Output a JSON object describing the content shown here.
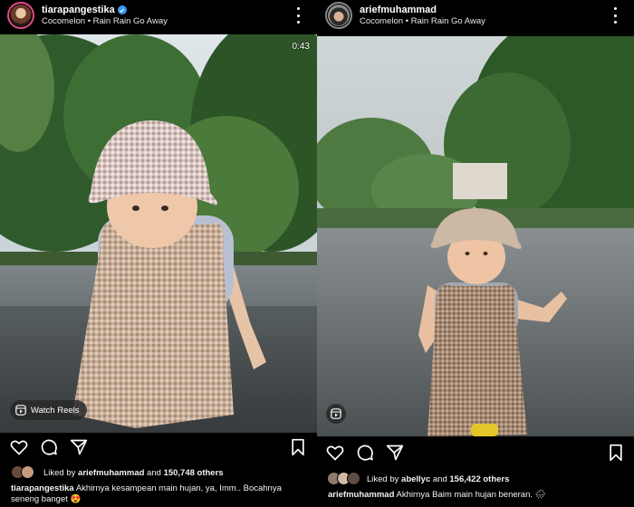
{
  "posts": [
    {
      "username": "tiarapangestika",
      "verified": true,
      "song": "Cocomelon • Rain Rain Go Away",
      "timer": "0:43",
      "badge": "Watch Reels",
      "liked_by_prefix": "Liked by ",
      "liked_by_user": "ariefmuhammad",
      "liked_by_mid": " and ",
      "likes_count": "150,748 others",
      "caption_user": "tiarapangestika",
      "caption_text": " Akhirnya kesampean main hujan, ya, Imm.. Bocahnya seneng banget 😍"
    },
    {
      "username": "ariefmuhammad",
      "verified": false,
      "song": "Cocomelon • Rain Rain Go Away",
      "liked_by_prefix": "Liked by ",
      "liked_by_user": "abellyc",
      "liked_by_mid": " and ",
      "likes_count": "156,422 others",
      "caption_user": "ariefmuhammad",
      "caption_text": " Akhirnya Baim main hujan beneran. 🌧"
    }
  ],
  "icons": [
    "verified-icon",
    "more-icon",
    "reels-icon",
    "heart-icon",
    "comment-icon",
    "share-icon",
    "bookmark-icon"
  ],
  "colors": {
    "background": "#000000",
    "verified": "#3897f0",
    "story_ring": "#e24a8d"
  }
}
